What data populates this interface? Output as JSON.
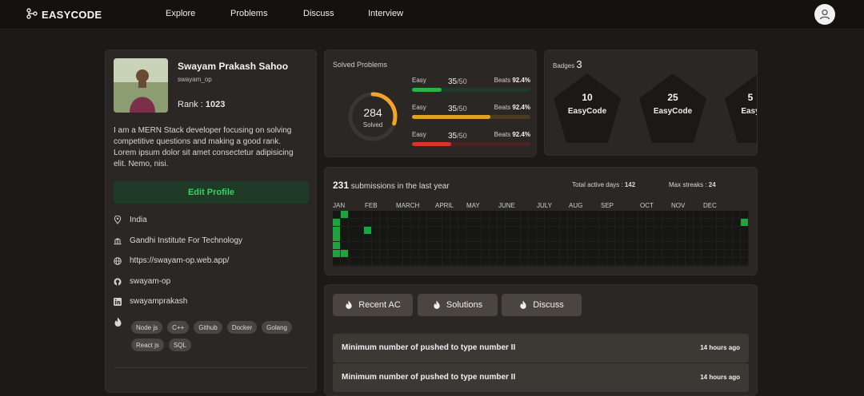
{
  "header": {
    "logo_part1": "EASY",
    "logo_part2": "CODE",
    "nav": [
      "Explore",
      "Problems",
      "Discuss",
      "Interview"
    ]
  },
  "profile": {
    "name": "Swayam Prakash Sahoo",
    "username": "swayam_op",
    "rank_label": "Rank : ",
    "rank_value": "1023",
    "bio": "I am a MERN Stack developer focusing on solving competitive questions and making a good rank. Lorem ipsum dolor sit amet consectetur adipisicing elit. Nemo, nisi.",
    "edit_label": "Edit Profile",
    "info": [
      {
        "icon": "location-pin-icon",
        "text": "India"
      },
      {
        "icon": "institution-icon",
        "text": "Gandhi Institute For Technology"
      },
      {
        "icon": "globe-icon",
        "text": "https://swayam-op.web.app/"
      },
      {
        "icon": "github-icon",
        "text": "swayam-op"
      },
      {
        "icon": "linkedin-icon",
        "text": "swayamprakash"
      }
    ],
    "skills_icon": "flame-icon",
    "skills": [
      "Node js",
      "C++",
      "Github",
      "Docker",
      "Golang",
      "React js",
      "SQL"
    ]
  },
  "solved": {
    "title": "Solved Problems",
    "total": "284",
    "total_label": "Solved",
    "ring_fraction": 0.3,
    "difficulties": [
      {
        "label": "Easy",
        "count": "35",
        "total": "/50",
        "beats_label": "Beats ",
        "beats": "92.4%",
        "fraction": 0.25,
        "color": "#2bb34a",
        "track": "#1f3a26"
      },
      {
        "label": "Easy",
        "count": "35",
        "total": "/50",
        "beats_label": "Beats ",
        "beats": "92.4%",
        "fraction": 0.66,
        "color": "#e0a323",
        "track": "#4a3c1f"
      },
      {
        "label": "Easy",
        "count": "35",
        "total": "/50",
        "beats_label": "Beats ",
        "beats": "92.4%",
        "fraction": 0.33,
        "color": "#d8342b",
        "track": "#4a2422"
      }
    ]
  },
  "badges": {
    "title": "Badges",
    "count": "3",
    "items": [
      {
        "number": "10",
        "label": "EasyCode"
      },
      {
        "number": "25",
        "label": "EasyCode"
      },
      {
        "number": "5",
        "label": "Easy"
      }
    ]
  },
  "submissions": {
    "count": "231",
    "text": " submissions in the last year",
    "active_label": "Total active days : ",
    "active_value": "142",
    "streak_label": "Max streaks : ",
    "streak_value": "24",
    "months": [
      "JAN",
      "FEB",
      "MARCH",
      "APRIL",
      "MAY",
      "JUNE",
      "JULY",
      "AUG",
      "SEP",
      "OCT",
      "NOV",
      "DEC"
    ],
    "active_color": "#1fa33d",
    "empty_color": "#161614"
  },
  "tabs": [
    {
      "icon": "flame-icon",
      "label": "Recent AC"
    },
    {
      "icon": "flame-icon",
      "label": "Solutions"
    },
    {
      "icon": "flame-icon",
      "label": "Discuss"
    }
  ],
  "recent": [
    {
      "title": "Minimum number of pushed to type number II",
      "time": "14 hours ago"
    },
    {
      "title": "Minimum number of pushed to type number II",
      "time": "14 hours ago"
    }
  ]
}
